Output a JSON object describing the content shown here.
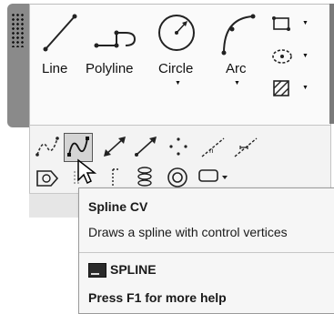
{
  "ribbon": {
    "tools": [
      {
        "label": "Line",
        "icon": "line-icon"
      },
      {
        "label": "Polyline",
        "icon": "polyline-icon"
      },
      {
        "label": "Circle",
        "icon": "circle-icon"
      },
      {
        "label": "Arc",
        "icon": "arc-icon"
      }
    ],
    "side_tools": [
      "rectangle-icon",
      "ellipse-icon",
      "hatch-icon"
    ],
    "row1_tools": [
      "spline-fit-icon",
      "spline-cv-icon",
      "construction-line-icon",
      "ray-icon",
      "multiple-points-icon",
      "divide-icon",
      "measure-icon"
    ],
    "row2_tools": [
      "region-icon",
      "wipeout-icon",
      "revision-cloud-icon",
      "helix-icon",
      "donut-icon",
      "boundary-icon"
    ]
  },
  "tooltip": {
    "title": "Spline CV",
    "description": "Draws a spline with control vertices",
    "command": "SPLINE",
    "help": "Press F1 for more help"
  }
}
